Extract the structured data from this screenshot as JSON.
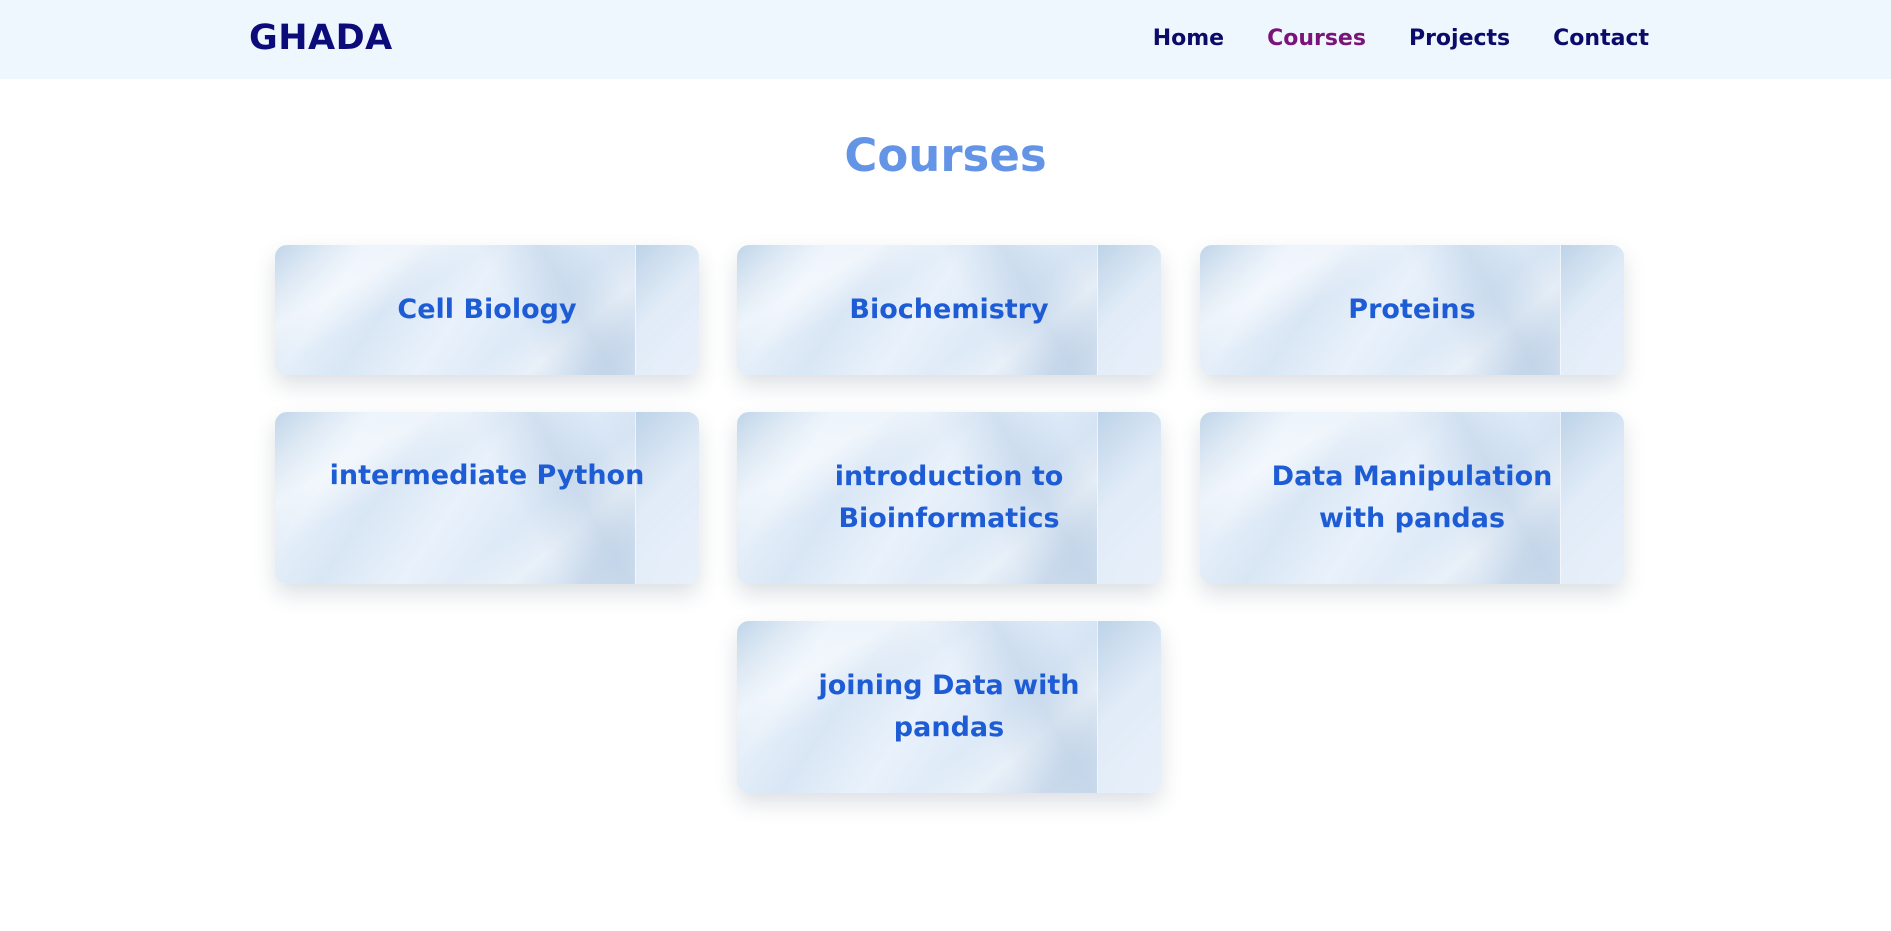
{
  "header": {
    "brand": "GHADA",
    "nav": [
      {
        "label": "Home",
        "active": false
      },
      {
        "label": "Courses",
        "active": true
      },
      {
        "label": "Projects",
        "active": false
      },
      {
        "label": "Contact",
        "active": false
      }
    ]
  },
  "main": {
    "title": "Courses",
    "courses": [
      {
        "label": "Cell Biology"
      },
      {
        "label": "Biochemistry"
      },
      {
        "label": "Proteins"
      },
      {
        "label": "intermediate Python"
      },
      {
        "label": "introduction to Bioinformatics"
      },
      {
        "label": "Data Manipulation with pandas"
      },
      {
        "label": "joining Data with pandas"
      }
    ]
  },
  "colors": {
    "topbar_bg": "#eef6fe",
    "brand": "#0b0b7a",
    "nav_text": "#0b0b6a",
    "nav_active": "#7a1478",
    "title": "#6494e6",
    "card_text": "#1e5cd6"
  }
}
